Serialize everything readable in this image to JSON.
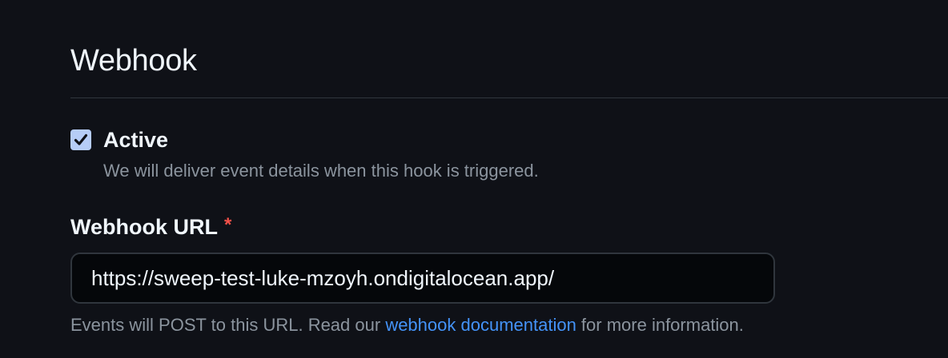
{
  "section": {
    "title": "Webhook"
  },
  "active": {
    "checked": true,
    "label": "Active",
    "description": "We will deliver event details when this hook is triggered."
  },
  "webhook_url": {
    "label": "Webhook URL",
    "required_marker": "*",
    "value": "https://sweep-test-luke-mzoyh.ondigitalocean.app/"
  },
  "help": {
    "prefix": "Events will POST to this URL. Read our ",
    "link_text": "webhook documentation",
    "suffix": " for more information."
  },
  "icons": {
    "checkbox": "checkmark-icon"
  },
  "colors": {
    "background": "#0f1117",
    "checkbox_fill": "#b6cdf7",
    "link": "#4493f8",
    "required": "#f85149"
  }
}
